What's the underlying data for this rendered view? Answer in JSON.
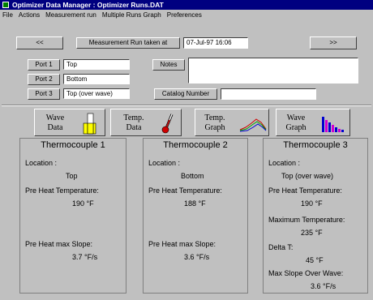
{
  "window": {
    "title": "Optimizer Data Manager  :  Optimizer Runs.DAT"
  },
  "menu": [
    "File",
    "Actions",
    "Measurement run",
    "Multiple Runs Graph",
    "Preferences"
  ],
  "nav": {
    "prev_label": "<<",
    "next_label": ">>"
  },
  "measurement": {
    "label": "Measurement Run taken at",
    "value": "07-Jul-97  16:06"
  },
  "ports": [
    {
      "label": "Port 1",
      "value": "Top"
    },
    {
      "label": "Port 2",
      "value": "Bottom"
    },
    {
      "label": "Port 3",
      "value": "Top (over wave)"
    }
  ],
  "notes": {
    "label": "Notes",
    "value": ""
  },
  "catalog": {
    "label": "Catalog Number",
    "value": ""
  },
  "toolbar": [
    {
      "line1": "Wave",
      "line2": "Data",
      "icon": "wave-data-icon"
    },
    {
      "line1": "Temp.",
      "line2": "Data",
      "icon": "thermometer-icon"
    },
    {
      "line1": "Temp.",
      "line2": "Graph",
      "icon": "line-graph-icon"
    },
    {
      "line1": "Wave",
      "line2": "Graph",
      "icon": "bar-graph-icon"
    }
  ],
  "thermocouples": [
    {
      "title": "Thermocouple 1",
      "location_label": "Location :",
      "location": "Top",
      "preheat_label": "Pre Heat Temperature:",
      "preheat_value": "190  °F",
      "slope_label": "Pre Heat max Slope:",
      "slope_value": "3.7  °F/s"
    },
    {
      "title": "Thermocouple 2",
      "location_label": "Location :",
      "location": "Bottom",
      "preheat_label": "Pre Heat Temperature:",
      "preheat_value": "188  °F",
      "slope_label": "Pre Heat max Slope:",
      "slope_value": "3.6  °F/s"
    },
    {
      "title": "Thermocouple 3",
      "location_label": "Location :",
      "location": "Top (over wave)",
      "preheat_label": "Pre Heat Temperature:",
      "preheat_value": "190  °F",
      "max_label": "Maximum Temperature:",
      "max_value": "235  °F",
      "delta_label": "Delta T:",
      "delta_value": "45  °F",
      "wave_slope_label": "Max Slope Over Wave:",
      "wave_slope_value": "3.6  °F/s"
    }
  ]
}
